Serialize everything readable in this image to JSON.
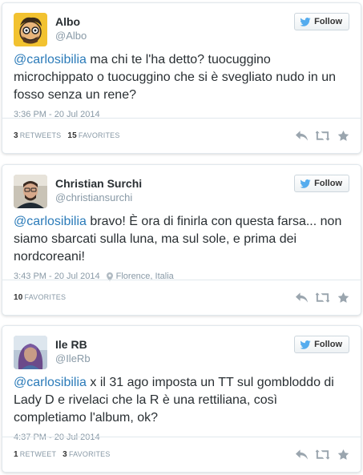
{
  "colors": {
    "mention": "#2b7bb9",
    "muted": "#8899a6",
    "border": "#e1e8ed",
    "text": "#292f33"
  },
  "follow_label": "Follow",
  "tweets": [
    {
      "name": "Albo",
      "handle": "@Albo",
      "mention": "@carlosibilia",
      "text": " ma chi te l'ha detto? tuocuggino microchippato o tuocuggino che si è svegliato nudo in un fosso senza un rene?",
      "time": "3:36 PM - 20 Jul 2014",
      "location": "",
      "retweets_count": "3",
      "retweets_label": "Retweets",
      "favorites_count": "15",
      "favorites_label": "Favorites"
    },
    {
      "name": "Christian Surchi",
      "handle": "@christiansurchi",
      "mention": "@carlosibilia",
      "text": " bravo! È ora di finirla con questa farsa... non siamo sbarcati sulla luna, ma sul sole, e prima dei nordcoreani!",
      "time": "3:43 PM - 20 Jul 2014",
      "location": "Florence, Italia",
      "favorites_count": "10",
      "favorites_label": "Favorites"
    },
    {
      "name": "Ile RB",
      "handle": "@IleRb",
      "mention": "@carlosibilia",
      "text": " x il 31 ago imposta un TT sul gombloddo di Lady D e rivelaci che la R è una rettiliana, così completiamo l'album, ok?",
      "time": "4:37 PM - 20 Jul 2014",
      "location": "",
      "retweets_count": "1",
      "retweets_label": "Retweet",
      "favorites_count": "3",
      "favorites_label": "Favorites"
    }
  ],
  "icons": [
    "twitter-bird-icon",
    "reply-icon",
    "retweet-icon",
    "favorite-star-icon",
    "location-pin-icon"
  ]
}
